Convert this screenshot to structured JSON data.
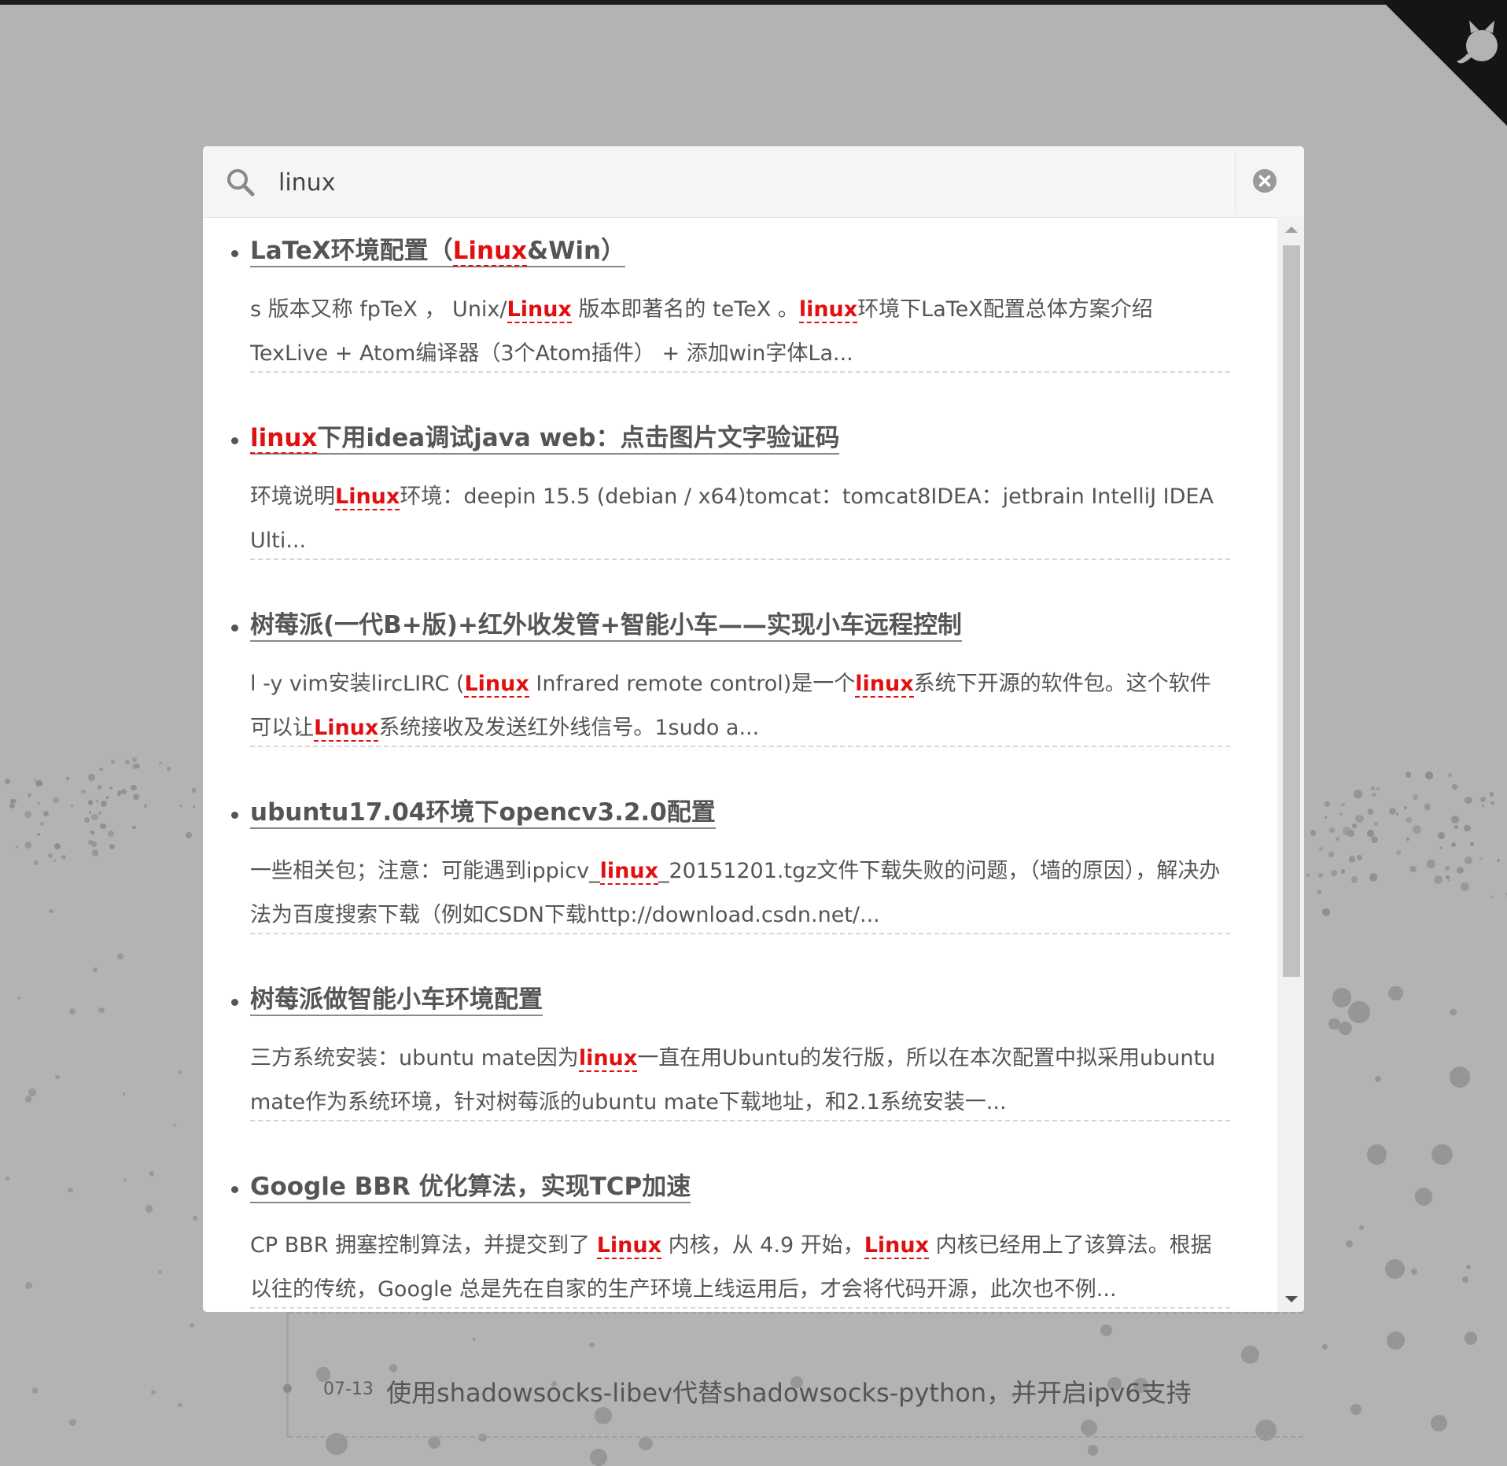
{
  "search": {
    "value": "linux",
    "placeholder": ""
  },
  "results": [
    {
      "title": [
        {
          "t": "LaTeX环境配置（"
        },
        {
          "t": "Linux",
          "h": true
        },
        {
          "t": "&Win）"
        }
      ],
      "excerpt": [
        {
          "t": "s 版本又称 fpTeX ， Unix/"
        },
        {
          "t": "Linux",
          "h": true
        },
        {
          "t": " 版本即著名的 teTeX 。"
        },
        {
          "t": "linux",
          "h": true
        },
        {
          "t": "环境下LaTeX配置总体方案介绍TexLive + Atom编译器（3个Atom插件） + 添加win字体La..."
        }
      ]
    },
    {
      "title": [
        {
          "t": "linux",
          "h": true
        },
        {
          "t": "下用idea调试java web：点击图片文字验证码"
        }
      ],
      "excerpt": [
        {
          "t": "环境说明"
        },
        {
          "t": "Linux",
          "h": true
        },
        {
          "t": "环境：deepin 15.5 (debian / x64)tomcat：tomcat8IDEA：jetbrain IntelliJ IDEA Ulti..."
        }
      ]
    },
    {
      "title": [
        {
          "t": "树莓派(一代B+版)+红外收发管+智能小车——实现小车远程控制"
        }
      ],
      "excerpt": [
        {
          "t": "l -y vim安装lircLIRC ("
        },
        {
          "t": "Linux",
          "h": true
        },
        {
          "t": " Infrared remote control)是一个"
        },
        {
          "t": "linux",
          "h": true
        },
        {
          "t": "系统下开源的软件包。这个软件可以让"
        },
        {
          "t": "Linux",
          "h": true
        },
        {
          "t": "系统接收及发送红外线信号。1sudo a..."
        }
      ]
    },
    {
      "title": [
        {
          "t": "ubuntu17.04环境下opencv3.2.0配置"
        }
      ],
      "excerpt": [
        {
          "t": "一些相关包；注意：可能遇到ippicv_"
        },
        {
          "t": "linux",
          "h": true
        },
        {
          "t": "_20151201.tgz文件下载失败的问题，（墙的原因），解决办法为百度搜索下载（例如CSDN下载http://download.csdn.net/..."
        }
      ]
    },
    {
      "title": [
        {
          "t": "树莓派做智能小车环境配置"
        }
      ],
      "excerpt": [
        {
          "t": "三方系统安装：ubuntu mate因为"
        },
        {
          "t": "linux",
          "h": true
        },
        {
          "t": "一直在用Ubuntu的发行版，所以在本次配置中拟采用ubuntu mate作为系统环境，针对树莓派的ubuntu mate下载地址，和2.1系统安装一..."
        }
      ]
    },
    {
      "title": [
        {
          "t": "Google BBR 优化算法，实现TCP加速"
        }
      ],
      "excerpt": [
        {
          "t": "CP BBR 拥塞控制算法，并提交到了 "
        },
        {
          "t": "Linux",
          "h": true
        },
        {
          "t": " 内核，从 4.9 开始，"
        },
        {
          "t": "Linux",
          "h": true
        },
        {
          "t": " 内核已经用上了该算法。根据以往的传统，Google 总是先在自家的生产环境上线运用后，才会将代码开源，此次也不例..."
        }
      ]
    }
  ],
  "background_post": {
    "date": "07-13",
    "title": "使用shadowsocks-libev代替shadowsocks-python，并开启ipv6支持"
  },
  "colors": {
    "highlight": "#e01010",
    "backdrop": "#b3b3b3",
    "corner": "#151515"
  },
  "icons": {
    "search": "search-icon",
    "clear": "close-icon",
    "github": "github-icon"
  }
}
